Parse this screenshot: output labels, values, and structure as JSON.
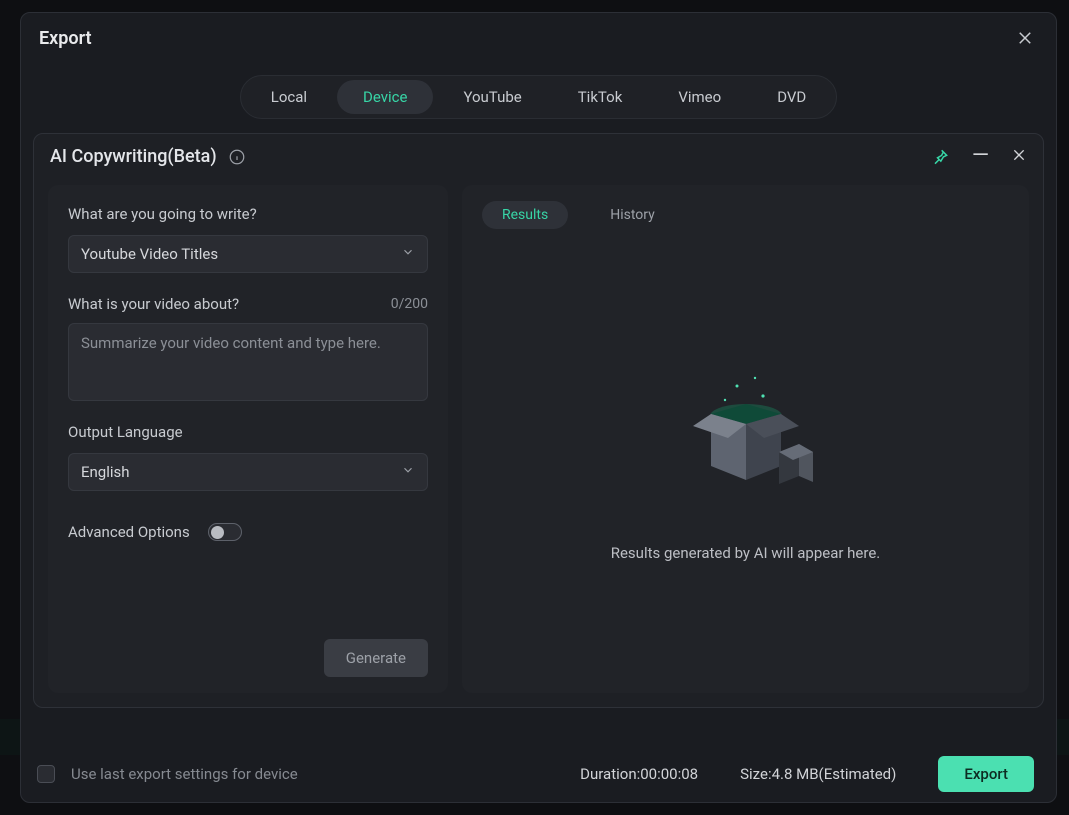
{
  "dialog": {
    "title": "Export",
    "tabs": [
      "Local",
      "Device",
      "YouTube",
      "TikTok",
      "Vimeo",
      "DVD"
    ],
    "active_tab": "Device"
  },
  "ai_panel": {
    "title": "AI Copywriting(Beta)",
    "q1_label": "What are you going to write?",
    "write_type_selected": "Youtube Video Titles",
    "q2_label": "What is your video about?",
    "char_count": "0/200",
    "about_placeholder": "Summarize your video content and type here.",
    "about_value": "",
    "output_lang_label": "Output Language",
    "output_lang_selected": "English",
    "advanced_label": "Advanced Options",
    "advanced_on": false,
    "generate_label": "Generate"
  },
  "results": {
    "tabs": [
      "Results",
      "History"
    ],
    "active": "Results",
    "placeholder_text": "Results generated by AI will appear here."
  },
  "footer": {
    "use_last_label": "Use last export settings for device",
    "duration_label": "Duration:",
    "duration_value": "00:00:08",
    "size_label": "Size:",
    "size_value": "4.8 MB(Estimated)",
    "export_btn": "Export"
  },
  "icons": {
    "close": "close-icon",
    "info": "info-icon",
    "pin": "pin-icon",
    "minimize": "minimize-icon",
    "chevron_down": "chevron-down-icon"
  }
}
